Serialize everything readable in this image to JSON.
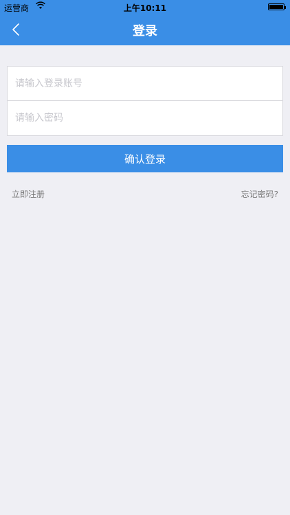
{
  "status_bar": {
    "carrier": "运营商",
    "time": "上午10:11",
    "wifi_icon": "wifi-icon",
    "battery_icon": "battery-icon"
  },
  "nav": {
    "title": "登录",
    "back_icon": "chevron-left-icon"
  },
  "form": {
    "account_placeholder": "请输入登录账号",
    "password_placeholder": "请输入密码"
  },
  "actions": {
    "login_label": "确认登录",
    "register_label": "立即注册",
    "forgot_label": "忘记密码?"
  },
  "colors": {
    "accent": "#3a8ee6",
    "background": "#efeff4"
  }
}
